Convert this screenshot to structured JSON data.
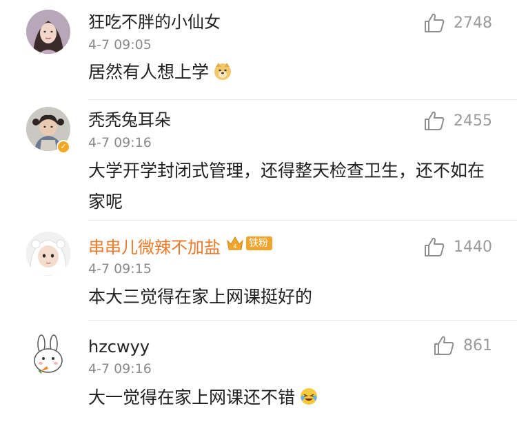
{
  "comments": [
    {
      "username": "狂吃不胖的小仙女",
      "time": "4-7 09:05",
      "text": "居然有人想上学",
      "text_emoji": "doge-emoji",
      "likes": "2748",
      "avatar_icon": "girl-portrait-avatar"
    },
    {
      "username": "秃秃兔耳朵",
      "time": "4-7 09:16",
      "text": "大学开学封闭式管理，还得整天检查卫生，还不如在家呢",
      "likes": "2455",
      "avatar_icon": "child-portrait-avatar",
      "verified": true
    },
    {
      "username": "串串儿微辣不加盐",
      "time": "4-7 09:15",
      "text": "本大三觉得在家上网课挺好的",
      "likes": "1440",
      "avatar_icon": "baby-portrait-avatar",
      "badge": "铁粉",
      "badge_level": "4",
      "username_color": "#ec7a2a"
    },
    {
      "username": "hzcwyy",
      "time": "4-7 09:16",
      "text": "大一觉得在家上网课还不错",
      "text_emoji": "laugh-cry-emoji",
      "likes": "861",
      "avatar_icon": "rabbit-cartoon-avatar"
    }
  ],
  "colors": {
    "vip_name": "#ec7a2a",
    "badge": "#f1a52c",
    "time": "#8a8a8a",
    "like_count": "#9a9a9a"
  }
}
